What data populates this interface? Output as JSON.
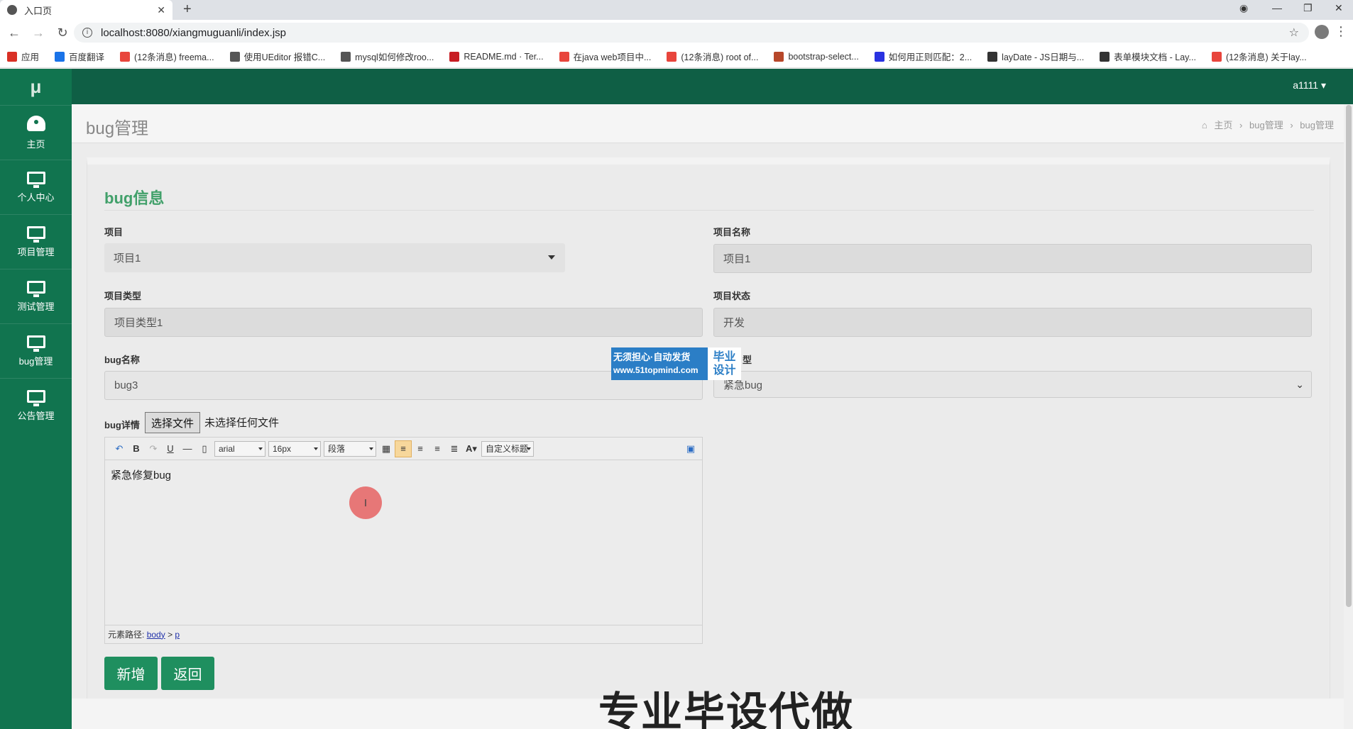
{
  "browser": {
    "tab_title": "入口页",
    "url": "localhost:8080/xiangmuguanli/index.jsp",
    "bookmarks": [
      {
        "label": "应用",
        "color": "#d93025"
      },
      {
        "label": "百度翻译",
        "color": "#1a73e8"
      },
      {
        "label": "(12条消息) freema...",
        "color": "#e8453c"
      },
      {
        "label": "使用UEditor 报错C...",
        "color": "#555555"
      },
      {
        "label": "mysql如何修改roo...",
        "color": "#555555"
      },
      {
        "label": "README.md · Ter...",
        "color": "#c71d23"
      },
      {
        "label": "在java web项目中...",
        "color": "#e8453c"
      },
      {
        "label": "(12条消息) root of...",
        "color": "#e8453c"
      },
      {
        "label": "bootstrap-select...",
        "color": "#b7472a"
      },
      {
        "label": "如何用正则匹配：2...",
        "color": "#2932e1"
      },
      {
        "label": "layDate - JS日期与...",
        "color": "#333333"
      },
      {
        "label": "表单模块文档 - Lay...",
        "color": "#333333"
      },
      {
        "label": "(12条消息) 关于lay...",
        "color": "#e8453c"
      }
    ]
  },
  "app": {
    "logo": "μ",
    "user": "a1111 ▾",
    "accent": "#11744f",
    "nav": [
      {
        "label": "主页",
        "icon": "dashboard-icon"
      },
      {
        "label": "个人中心",
        "icon": "monitor-icon"
      },
      {
        "label": "项目管理",
        "icon": "monitor-icon"
      },
      {
        "label": "测试管理",
        "icon": "monitor-icon"
      },
      {
        "label": "bug管理",
        "icon": "monitor-icon"
      },
      {
        "label": "公告管理",
        "icon": "monitor-icon"
      }
    ]
  },
  "page": {
    "title": "bug管理",
    "breadcrumb": [
      "主页",
      "bug管理",
      "bug管理"
    ],
    "card_title": "bug信息"
  },
  "form": {
    "project_label": "项目",
    "project_value": "项目1",
    "project_name_label": "项目名称",
    "project_name_value": "项目1",
    "project_type_label": "项目类型",
    "project_type_value": "项目类型1",
    "project_status_label": "项目状态",
    "project_status_value": "开发",
    "bug_name_label": "bug名称",
    "bug_name_value": "bug3",
    "bug_type_label_partial": "型",
    "bug_type_value": "紧急bug",
    "bug_detail_label": "bug详情",
    "file_button": "选择文件",
    "file_none": "未选择任何文件",
    "editor": {
      "font": "arial",
      "size": "16px",
      "paragraph": "段落",
      "custom_title": "自定义标题",
      "content": "紧急修复bug",
      "path_label": "元素路径:",
      "path_body": "body",
      "path_sep": ">",
      "path_p": "p"
    },
    "add_button": "新增",
    "back_button": "返回"
  },
  "overlay": {
    "ad_line1": "无须担心·自动发货",
    "ad_line2": "www.51topmind.com",
    "ad_right1": "毕业",
    "ad_right2": "设计",
    "watermark": "专业毕设代做"
  }
}
